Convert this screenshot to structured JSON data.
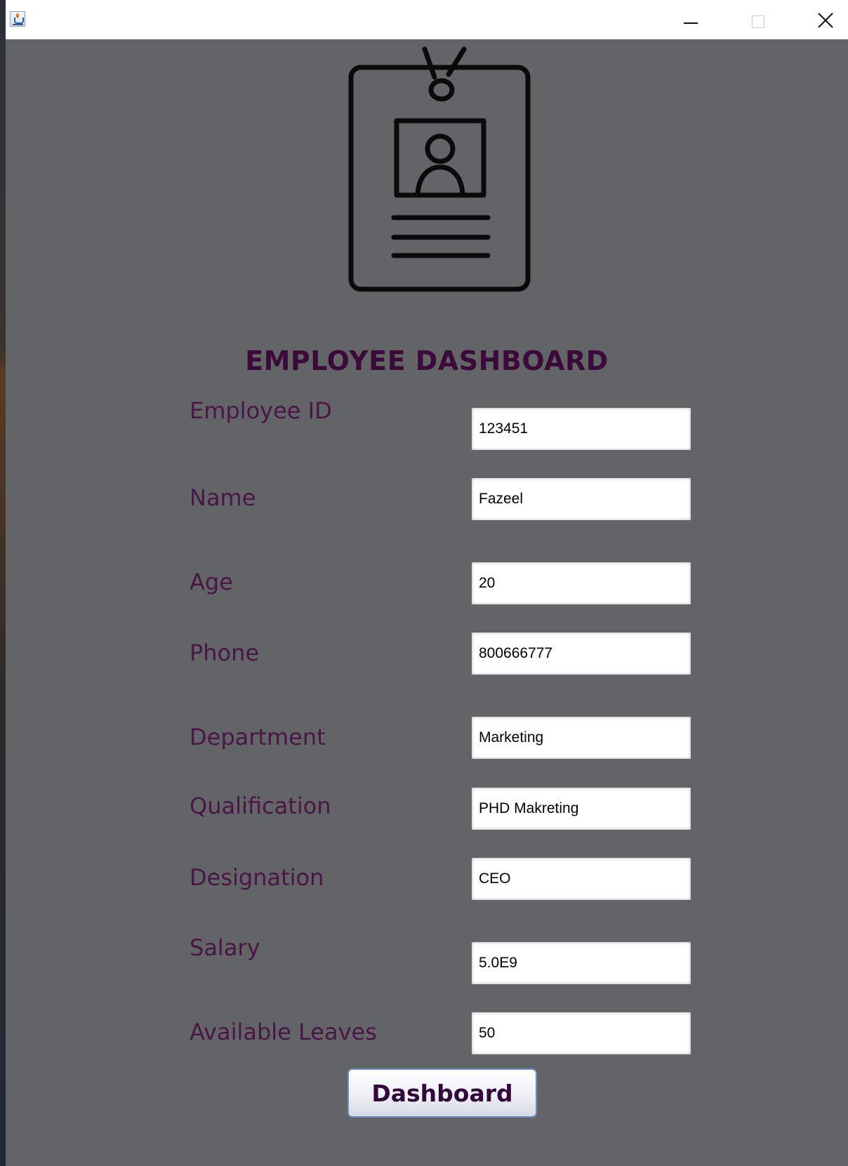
{
  "window": {
    "title": "",
    "icon": "java-cup-icon",
    "controls": [
      "minimize-icon",
      "maximize-icon",
      "close-icon"
    ]
  },
  "dashboard": {
    "title": "EMPLOYEE DASHBOARD",
    "badge_icon": "id-badge-icon",
    "fields": {
      "employee_id": {
        "label": "Employee ID",
        "value": "123451"
      },
      "name": {
        "label": "Name",
        "value": "Fazeel"
      },
      "age": {
        "label": "Age",
        "value": "20"
      },
      "phone": {
        "label": "Phone",
        "value": "800666777"
      },
      "department": {
        "label": "Department",
        "value": "Marketing"
      },
      "qualification": {
        "label": "Qualification",
        "value": "PHD Makreting"
      },
      "designation": {
        "label": "Designation",
        "value": "CEO"
      },
      "salary": {
        "label": "Salary",
        "value": "5.0E9"
      },
      "available_leaves": {
        "label": "Available Leaves",
        "value": "50"
      }
    },
    "button_label": "Dashboard"
  },
  "colors": {
    "background": "#636466",
    "title": "#3b0a3b",
    "label": "#4a1548",
    "button_text": "#33083a"
  }
}
